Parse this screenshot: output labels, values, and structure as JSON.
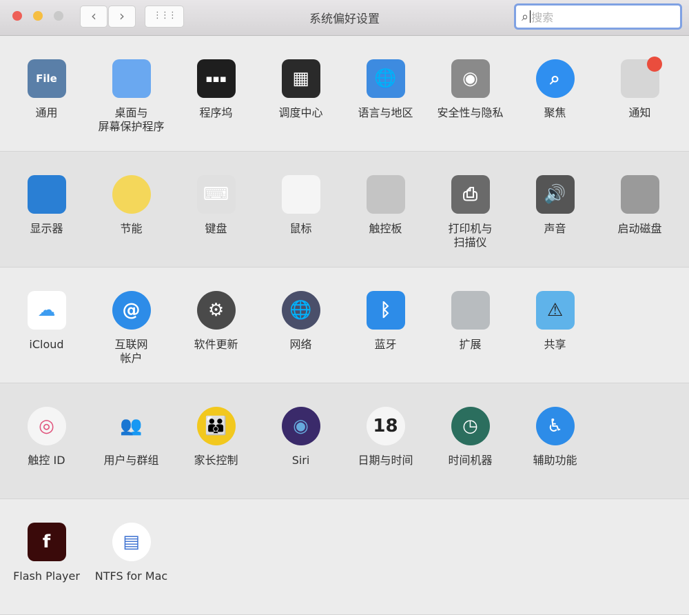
{
  "window": {
    "title": "系统偏好设置",
    "traffic_lights": [
      "#ee5f57",
      "#f6be41",
      "#c9c9c9"
    ],
    "back": "‹",
    "forward": "›",
    "grid": "⋮⋮⋮"
  },
  "search": {
    "placeholder": "搜索",
    "value": ""
  },
  "sections": [
    {
      "items": [
        {
          "label": "通用",
          "icon": "general-icon",
          "bg": "#5a7fa8",
          "glyph": "File"
        },
        {
          "label": "桌面与\n屏幕保护程序",
          "icon": "desktop-icon",
          "bg": "#6aa8f0",
          "glyph": ""
        },
        {
          "label": "程序坞",
          "icon": "dock-icon",
          "bg": "#1e1e1e",
          "glyph": "▪▪▪"
        },
        {
          "label": "调度中心",
          "icon": "mission-control-icon",
          "bg": "#2a2a2a",
          "glyph": "▦"
        },
        {
          "label": "语言与地区",
          "icon": "language-region-icon",
          "bg": "#3d8be0",
          "glyph": "🌐"
        },
        {
          "label": "安全性与隐私",
          "icon": "security-icon",
          "bg": "#8a8a8a",
          "glyph": "◉"
        },
        {
          "label": "聚焦",
          "icon": "spotlight-icon",
          "bg": "#2f8ff0",
          "glyph": "⌕",
          "round": true
        },
        {
          "label": "通知",
          "icon": "notifications-icon",
          "bg": "#d6d6d6",
          "glyph": "",
          "badge": true
        }
      ]
    },
    {
      "items": [
        {
          "label": "显示器",
          "icon": "displays-icon",
          "bg": "#2a7fd4",
          "glyph": ""
        },
        {
          "label": "节能",
          "icon": "energy-saver-icon",
          "bg": "#f4d75a",
          "glyph": "",
          "round": true
        },
        {
          "label": "键盘",
          "icon": "keyboard-icon",
          "bg": "#e0e0e0",
          "glyph": "⌨"
        },
        {
          "label": "鼠标",
          "icon": "mouse-icon",
          "bg": "#f5f5f5",
          "glyph": ""
        },
        {
          "label": "触控板",
          "icon": "trackpad-icon",
          "bg": "#c4c4c4",
          "glyph": ""
        },
        {
          "label": "打印机与\n扫描仪",
          "icon": "printers-icon",
          "bg": "#6a6a6a",
          "glyph": "⎙"
        },
        {
          "label": "声音",
          "icon": "sound-icon",
          "bg": "#555555",
          "glyph": "🔊"
        },
        {
          "label": "启动磁盘",
          "icon": "startup-disk-icon",
          "bg": "#9a9a9a",
          "glyph": ""
        }
      ]
    },
    {
      "items": [
        {
          "label": "iCloud",
          "icon": "icloud-icon",
          "bg": "#ffffff",
          "glyph": "☁",
          "fg": "#3d9cf0"
        },
        {
          "label": "互联网\n帐户",
          "icon": "internet-accounts-icon",
          "bg": "#2d8ce8",
          "glyph": "@",
          "round": true
        },
        {
          "label": "软件更新",
          "icon": "software-update-icon",
          "bg": "#4a4a4a",
          "glyph": "⚙",
          "round": true
        },
        {
          "label": "网络",
          "icon": "network-icon",
          "bg": "#4a4f6a",
          "glyph": "🌐",
          "round": true
        },
        {
          "label": "蓝牙",
          "icon": "bluetooth-icon",
          "bg": "#2d8ce8",
          "glyph": "ᛒ"
        },
        {
          "label": "扩展",
          "icon": "extensions-icon",
          "bg": "#b8bcbf",
          "glyph": ""
        },
        {
          "label": "共享",
          "icon": "sharing-icon",
          "bg": "#5fb3ea",
          "glyph": "⚠",
          "fg": "#222"
        }
      ]
    },
    {
      "items": [
        {
          "label": "触控 ID",
          "icon": "touch-id-icon",
          "bg": "#f5f5f5",
          "glyph": "◎",
          "fg": "#e0507a",
          "round": true
        },
        {
          "label": "用户与群组",
          "icon": "users-groups-icon",
          "bg": "transparent",
          "glyph": "👥",
          "fg": "#555"
        },
        {
          "label": "家长控制",
          "icon": "parental-controls-icon",
          "bg": "#f2c81e",
          "glyph": "👪",
          "fg": "#222",
          "round": true
        },
        {
          "label": "Siri",
          "icon": "siri-icon",
          "bg": "#3a2a6a",
          "glyph": "◉",
          "fg": "#6ad",
          "round": true
        },
        {
          "label": "日期与时间",
          "icon": "date-time-icon",
          "bg": "#f5f5f5",
          "glyph": "18",
          "fg": "#222",
          "round": true
        },
        {
          "label": "时间机器",
          "icon": "time-machine-icon",
          "bg": "#2b6e5e",
          "glyph": "◷",
          "round": true
        },
        {
          "label": "辅助功能",
          "icon": "accessibility-icon",
          "bg": "#2d8ce8",
          "glyph": "♿",
          "round": true
        }
      ]
    },
    {
      "items": [
        {
          "label": "Flash Player",
          "icon": "flash-player-icon",
          "bg": "#3a0a0a",
          "glyph": "f"
        },
        {
          "label": "NTFS for Mac",
          "icon": "ntfs-icon",
          "bg": "#ffffff",
          "glyph": "▤",
          "fg": "#3a6fd0",
          "round": true
        }
      ]
    }
  ]
}
